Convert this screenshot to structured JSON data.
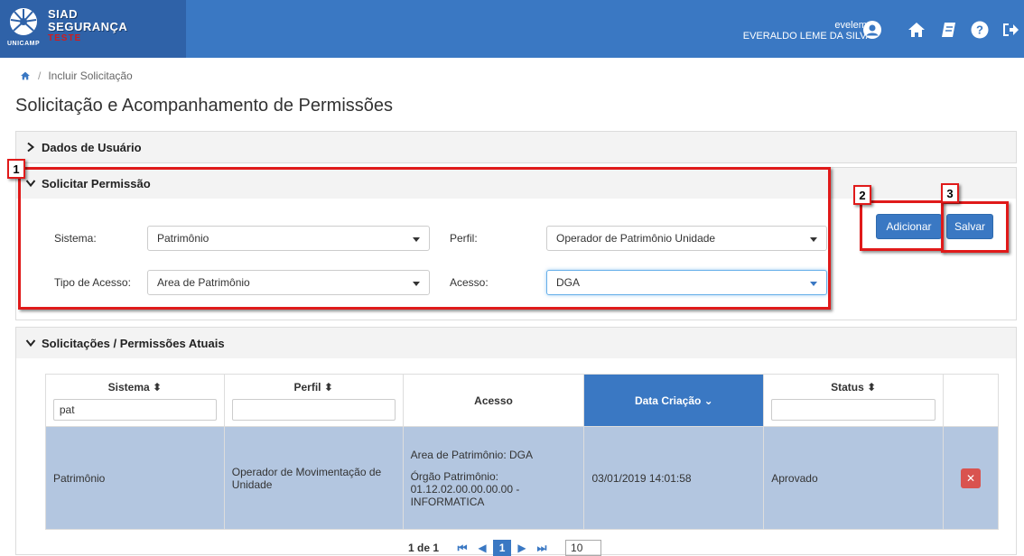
{
  "header": {
    "logo": {
      "line1": "SIAD",
      "line2": "SEGURANÇA",
      "env": "TESTE",
      "org": "UNICAMP"
    },
    "user": {
      "login": "eveleme",
      "name": "EVERALDO LEME DA SILVA"
    },
    "icons": [
      "user-circle-icon",
      "home-icon",
      "book-icon",
      "help-icon",
      "logout-icon"
    ],
    "colors": {
      "bar": "#3a78c3",
      "logo_bg": "#2f62a8"
    }
  },
  "breadcrumb": {
    "current": "Incluir Solicitação"
  },
  "page_title": "Solicitação e Acompanhamento de Permissões",
  "panels": {
    "dados_usuario": {
      "title": "Dados de Usuário"
    },
    "solicitar": {
      "title": "Solicitar Permissão",
      "sistema_label": "Sistema:",
      "sistema_value": "Patrimônio",
      "perfil_label": "Perfil:",
      "perfil_value": "Operador de Patrimônio Unidade",
      "tipo_label": "Tipo de Acesso:",
      "tipo_value": "Area de Patrimônio",
      "acesso_label": "Acesso:",
      "acesso_value": "DGA"
    },
    "atuais": {
      "title": "Solicitações / Permissões Atuais"
    }
  },
  "buttons": {
    "adicionar": "Adicionar",
    "salvar": "Salvar"
  },
  "callouts": [
    "1",
    "2",
    "3"
  ],
  "table": {
    "columns": [
      "Sistema ⬍",
      "Perfil ⬍",
      "Acesso",
      "Data Criação ⌄",
      "Status ⬍"
    ],
    "filters": {
      "sistema": "pat",
      "perfil": "",
      "status": ""
    },
    "rows": [
      {
        "sistema": "Patrimônio",
        "perfil": "Operador de Movimentação de Unidade",
        "acesso_line1": "Area de Patrimônio: DGA",
        "acesso_line2": "Órgão Patrimônio: 01.12.02.00.00.00.00 - INFORMATICA",
        "data": "03/01/2019 14:01:58",
        "status": "Aprovado"
      }
    ]
  },
  "pager": {
    "info": "1 de 1",
    "page": "1",
    "page_size": "10"
  }
}
